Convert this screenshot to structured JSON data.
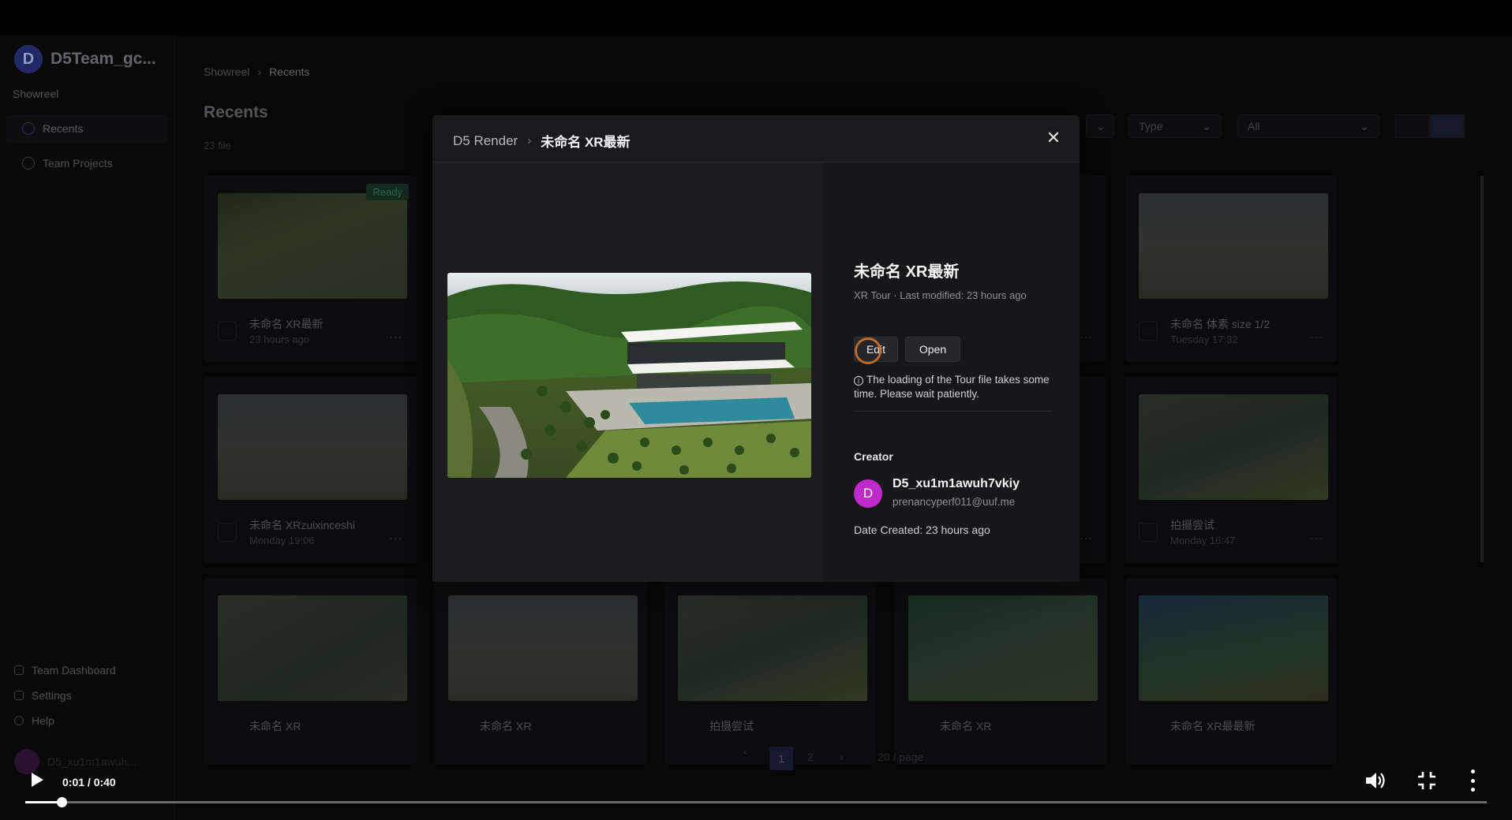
{
  "sidebar": {
    "team_initial": "D",
    "team_name": "D5Team_gc...",
    "section": "Showreel",
    "items": [
      {
        "label": "Recents"
      },
      {
        "label": "Team Projects"
      }
    ],
    "bottom": [
      {
        "label": "Team Dashboard"
      },
      {
        "label": "Settings"
      },
      {
        "label": "Help"
      }
    ],
    "user_name": "D5_xu1m1awuh..."
  },
  "main": {
    "breadcrumb": [
      "Showreel",
      "Recents"
    ],
    "title": "Recents",
    "file_count": "23 file",
    "filters": {
      "type": "Type",
      "all": "All"
    },
    "cards": [
      {
        "name": "未命名 XR最新",
        "date": "23 hours ago",
        "badge": "Ready"
      },
      {
        "name": "未命名 体素 size 1/2",
        "date": "Tuesday 17:32"
      },
      {
        "name": "未命名 XRzuixinceshi",
        "date": "Monday 19:06"
      },
      {
        "name": "拍摄尝试",
        "date": "Monday 16:47"
      },
      {
        "name": "未命名 XR"
      },
      {
        "name": "未命名 XR"
      },
      {
        "name": "拍摄尝试"
      },
      {
        "name": "未命名 XR"
      },
      {
        "name": "未命名 XR最最新"
      }
    ],
    "pagination": {
      "current": "1",
      "next": "2",
      "page_size": "20 / page"
    }
  },
  "modal": {
    "breadcrumb_root": "D5 Render",
    "breadcrumb_current": "未命名 XR最新",
    "file_title": "未命名 XR最新",
    "file_meta": "XR Tour · Last modified:  23 hours ago",
    "edit_label": "Edit",
    "open_label": "Open",
    "notice": "The loading of the Tour file takes some time. Please wait patiently.",
    "creator_label": "Creator",
    "creator_initial": "D",
    "creator_name": "D5_xu1m1awuh7vkiy",
    "creator_email": "prenancyperf011@uuf.me",
    "date_created": "Date Created: 23 hours ago"
  },
  "video": {
    "time": "0:01 / 0:40",
    "progress": 0.025
  },
  "colors": {
    "accent_purple": "#c02acb",
    "cursor_ring": "#c06a2a",
    "ready_badge": "#3f8a63"
  }
}
